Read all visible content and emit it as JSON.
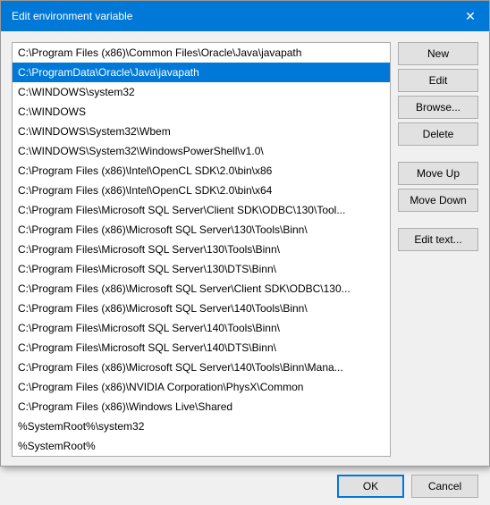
{
  "dialog": {
    "title": "Edit environment variable",
    "close_label": "✕"
  },
  "list": {
    "items": [
      {
        "text": "C:\\Program Files (x86)\\Common Files\\Oracle\\Java\\javapath",
        "selected": false
      },
      {
        "text": "C:\\ProgramData\\Oracle\\Java\\javapath",
        "selected": true
      },
      {
        "text": "C:\\WINDOWS\\system32",
        "selected": false
      },
      {
        "text": "C:\\WINDOWS",
        "selected": false
      },
      {
        "text": "C:\\WINDOWS\\System32\\Wbem",
        "selected": false
      },
      {
        "text": "C:\\WINDOWS\\System32\\WindowsPowerShell\\v1.0\\",
        "selected": false
      },
      {
        "text": "C:\\Program Files (x86)\\Intel\\OpenCL SDK\\2.0\\bin\\x86",
        "selected": false
      },
      {
        "text": "C:\\Program Files (x86)\\Intel\\OpenCL SDK\\2.0\\bin\\x64",
        "selected": false
      },
      {
        "text": "C:\\Program Files\\Microsoft SQL Server\\Client SDK\\ODBC\\130\\Tool...",
        "selected": false
      },
      {
        "text": "C:\\Program Files (x86)\\Microsoft SQL Server\\130\\Tools\\Binn\\",
        "selected": false
      },
      {
        "text": "C:\\Program Files\\Microsoft SQL Server\\130\\Tools\\Binn\\",
        "selected": false
      },
      {
        "text": "C:\\Program Files\\Microsoft SQL Server\\130\\DTS\\Binn\\",
        "selected": false
      },
      {
        "text": "C:\\Program Files (x86)\\Microsoft SQL Server\\Client SDK\\ODBC\\130...",
        "selected": false
      },
      {
        "text": "C:\\Program Files (x86)\\Microsoft SQL Server\\140\\Tools\\Binn\\",
        "selected": false
      },
      {
        "text": "C:\\Program Files\\Microsoft SQL Server\\140\\Tools\\Binn\\",
        "selected": false
      },
      {
        "text": "C:\\Program Files\\Microsoft SQL Server\\140\\DTS\\Binn\\",
        "selected": false
      },
      {
        "text": "C:\\Program Files (x86)\\Microsoft SQL Server\\140\\Tools\\Binn\\Mana...",
        "selected": false
      },
      {
        "text": "C:\\Program Files (x86)\\NVIDIA Corporation\\PhysX\\Common",
        "selected": false
      },
      {
        "text": "C:\\Program Files (x86)\\Windows Live\\Shared",
        "selected": false
      },
      {
        "text": "%SystemRoot%\\system32",
        "selected": false
      },
      {
        "text": "%SystemRoot%",
        "selected": false
      }
    ]
  },
  "buttons": {
    "new": "New",
    "edit": "Edit",
    "browse": "Browse...",
    "delete": "Delete",
    "move_up": "Move Up",
    "move_down": "Move Down",
    "edit_text": "Edit text..."
  },
  "footer": {
    "ok": "OK",
    "cancel": "Cancel"
  }
}
